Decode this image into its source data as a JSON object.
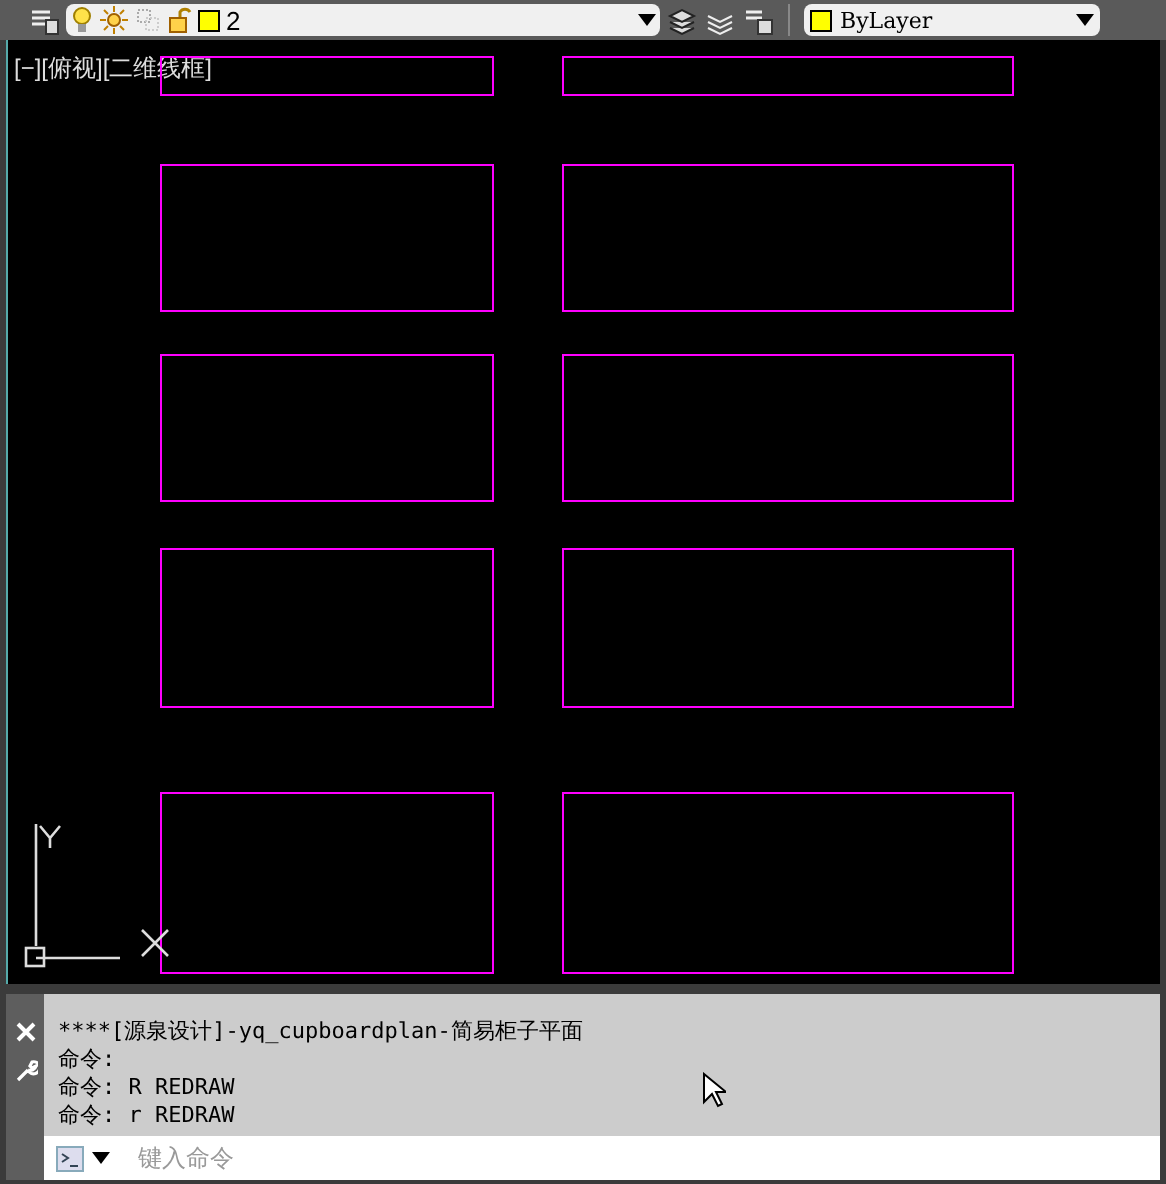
{
  "toolbar": {
    "layer_dropdown": {
      "value": "2",
      "color": "#ffff00"
    },
    "color_dropdown": {
      "value": "ByLayer",
      "color": "#ffff00"
    }
  },
  "viewport": {
    "label": "[−][俯视][二维线框]"
  },
  "command_history": [
    "****[源泉设计]-yq_cupboardplan-简易柜子平面",
    "命令:",
    "命令: R REDRAW",
    "命令: r REDRAW"
  ],
  "command_input": {
    "placeholder": "键入命令"
  }
}
